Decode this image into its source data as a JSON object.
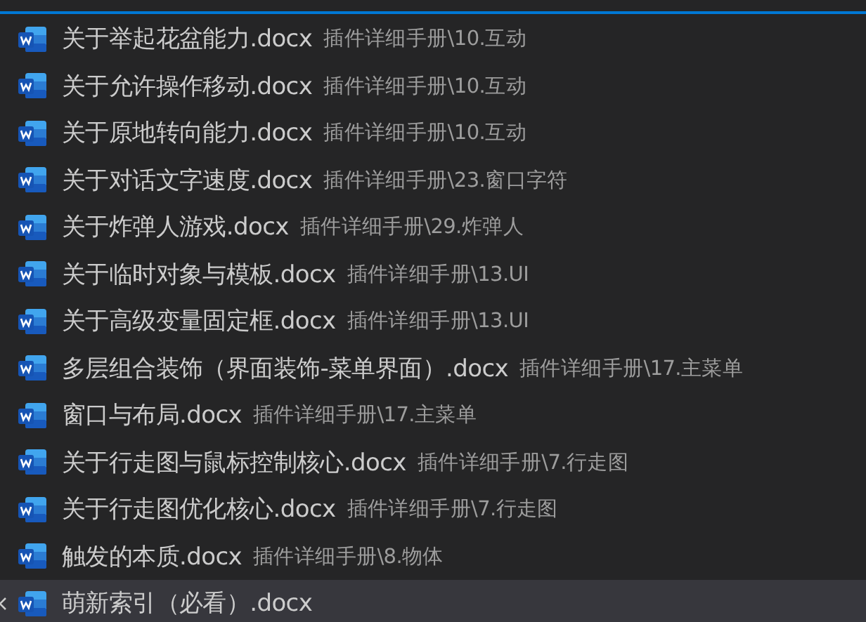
{
  "open_editors": [
    {
      "name": "关于举起花盆能力.docx",
      "path": "插件详细手册\\10.互动",
      "selected": false
    },
    {
      "name": "关于允许操作移动.docx",
      "path": "插件详细手册\\10.互动",
      "selected": false
    },
    {
      "name": "关于原地转向能力.docx",
      "path": "插件详细手册\\10.互动",
      "selected": false
    },
    {
      "name": "关于对话文字速度.docx",
      "path": "插件详细手册\\23.窗口字符",
      "selected": false
    },
    {
      "name": "关于炸弹人游戏.docx",
      "path": "插件详细手册\\29.炸弹人",
      "selected": false
    },
    {
      "name": "关于临时对象与模板.docx",
      "path": "插件详细手册\\13.UI",
      "selected": false
    },
    {
      "name": "关于高级变量固定框.docx",
      "path": "插件详细手册\\13.UI",
      "selected": false
    },
    {
      "name": "多层组合装饰（界面装饰-菜单界面）.docx",
      "path": "插件详细手册\\17.主菜单",
      "selected": false
    },
    {
      "name": "窗口与布局.docx",
      "path": "插件详细手册\\17.主菜单",
      "selected": false
    },
    {
      "name": "关于行走图与鼠标控制核心.docx",
      "path": "插件详细手册\\7.行走图",
      "selected": false
    },
    {
      "name": "关于行走图优化核心.docx",
      "path": "插件详细手册\\7.行走图",
      "selected": false
    },
    {
      "name": "触发的本质.docx",
      "path": "插件详细手册\\8.物体",
      "selected": false
    },
    {
      "name": "萌新索引（必看）.docx",
      "selected": true
    }
  ]
}
